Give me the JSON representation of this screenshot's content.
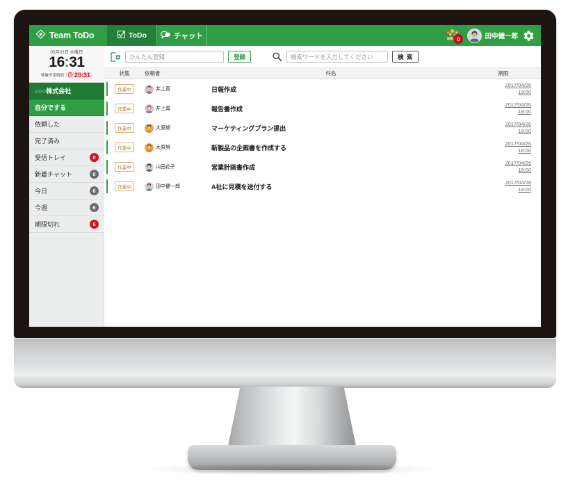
{
  "app": {
    "logo_text": "Team ToDo",
    "logo_icon": "diamond-logo-icon"
  },
  "tabs": [
    {
      "label": "ToDo",
      "icon": "checkbox-icon",
      "active": true
    },
    {
      "label": "チャット",
      "icon": "chat-bubble-icon",
      "active": false
    }
  ],
  "topbar": {
    "notification_icon": "flower-bouquet-icon",
    "notification_count": "0",
    "user_name": "田中健一郎",
    "avatar_icon": "user-avatar",
    "settings_icon": "gear-icon"
  },
  "sidebar": {
    "clock": {
      "date": "05月03日 水曜日",
      "hours": "16",
      "colon": ":",
      "minutes": "31",
      "end_label": "終業予定時刻",
      "end_icon": "alarm-clock-icon",
      "end_time": "20:31"
    },
    "items": [
      {
        "label": "○○○株式会社",
        "badge": "",
        "style": "company"
      },
      {
        "label": "自分でする",
        "badge": "",
        "style": "active"
      },
      {
        "label": "依頼した",
        "badge": "",
        "style": "plain"
      },
      {
        "label": "完了済み",
        "badge": "",
        "style": "plain"
      },
      {
        "label": "受信トレイ",
        "badge": "0",
        "style": "plain",
        "badge_color": "red"
      },
      {
        "label": "新着チャット",
        "badge": "0",
        "style": "plain",
        "badge_color": "grey"
      },
      {
        "label": "今日",
        "badge": "6",
        "style": "plain",
        "badge_color": "grey"
      },
      {
        "label": "今週",
        "badge": "6",
        "style": "plain",
        "badge_color": "grey"
      },
      {
        "label": "期限切れ",
        "badge": "6",
        "style": "plain",
        "badge_color": "red"
      }
    ]
  },
  "toolbar": {
    "add_icon": "add-task-icon",
    "add_placeholder": "かんたん登録",
    "add_value": "",
    "register_label": "登録",
    "search_icon": "search-icon",
    "search_placeholder": "検索ワードを入力してください",
    "search_value": "",
    "search_label": "検 索"
  },
  "table": {
    "headers": {
      "state": "状態",
      "user": "依頼者",
      "title": "件名",
      "due": "期限"
    },
    "rows": [
      {
        "state": "作業中",
        "user": "井上真",
        "avatar": "avatar-pink",
        "title": "日報作成",
        "due_date": "2017/04/26",
        "due_time": "18:00"
      },
      {
        "state": "作業中",
        "user": "井上真",
        "avatar": "avatar-pink",
        "title": "報告書作成",
        "due_date": "2017/04/26",
        "due_time": "18:00"
      },
      {
        "state": "作業中",
        "user": "大原努",
        "avatar": "avatar-orange",
        "title": "マーケティングプラン提出",
        "due_date": "2017/04/26",
        "due_time": "18:00"
      },
      {
        "state": "作業中",
        "user": "大原努",
        "avatar": "avatar-orange",
        "title": "新製品の企画書を作成する",
        "due_date": "2017/04/26",
        "due_time": "18:00"
      },
      {
        "state": "作業中",
        "user": "山田花子",
        "avatar": "avatar-teal",
        "title": "営業計画書作成",
        "due_date": "2017/04/26",
        "due_time": "18:00"
      },
      {
        "state": "作業中",
        "user": "田中健一郎",
        "avatar": "avatar-green",
        "title": "A社に見積を送付する",
        "due_date": "2017/04/28",
        "due_time": "18:00"
      }
    ]
  },
  "colors": {
    "brand_green": "#2f9e44",
    "brand_green_dark": "#1f7a34",
    "badge_red": "#cf1322",
    "badge_grey": "#6d6d6d",
    "state_border": "#d9b27a"
  }
}
